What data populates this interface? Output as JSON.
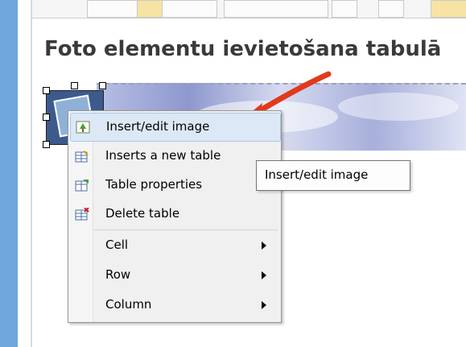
{
  "page": {
    "heading": "Foto elementu ievietošana tabulā"
  },
  "context_menu": {
    "items": [
      {
        "label": "Insert/edit image",
        "icon": "insert-image-icon"
      },
      {
        "label": "Inserts a new table",
        "icon": "insert-table-icon"
      },
      {
        "label": "Table properties",
        "icon": "table-properties-icon"
      },
      {
        "label": "Delete table",
        "icon": "delete-table-icon"
      },
      {
        "label": "Cell",
        "submenu": true
      },
      {
        "label": "Row",
        "submenu": true
      },
      {
        "label": "Column",
        "submenu": true
      }
    ]
  },
  "tooltip": {
    "text": "Insert/edit image"
  },
  "colors": {
    "accent_arrow": "#e03a1c",
    "highlight": "#dce8f5",
    "side_bar": "#6fa8dc"
  }
}
